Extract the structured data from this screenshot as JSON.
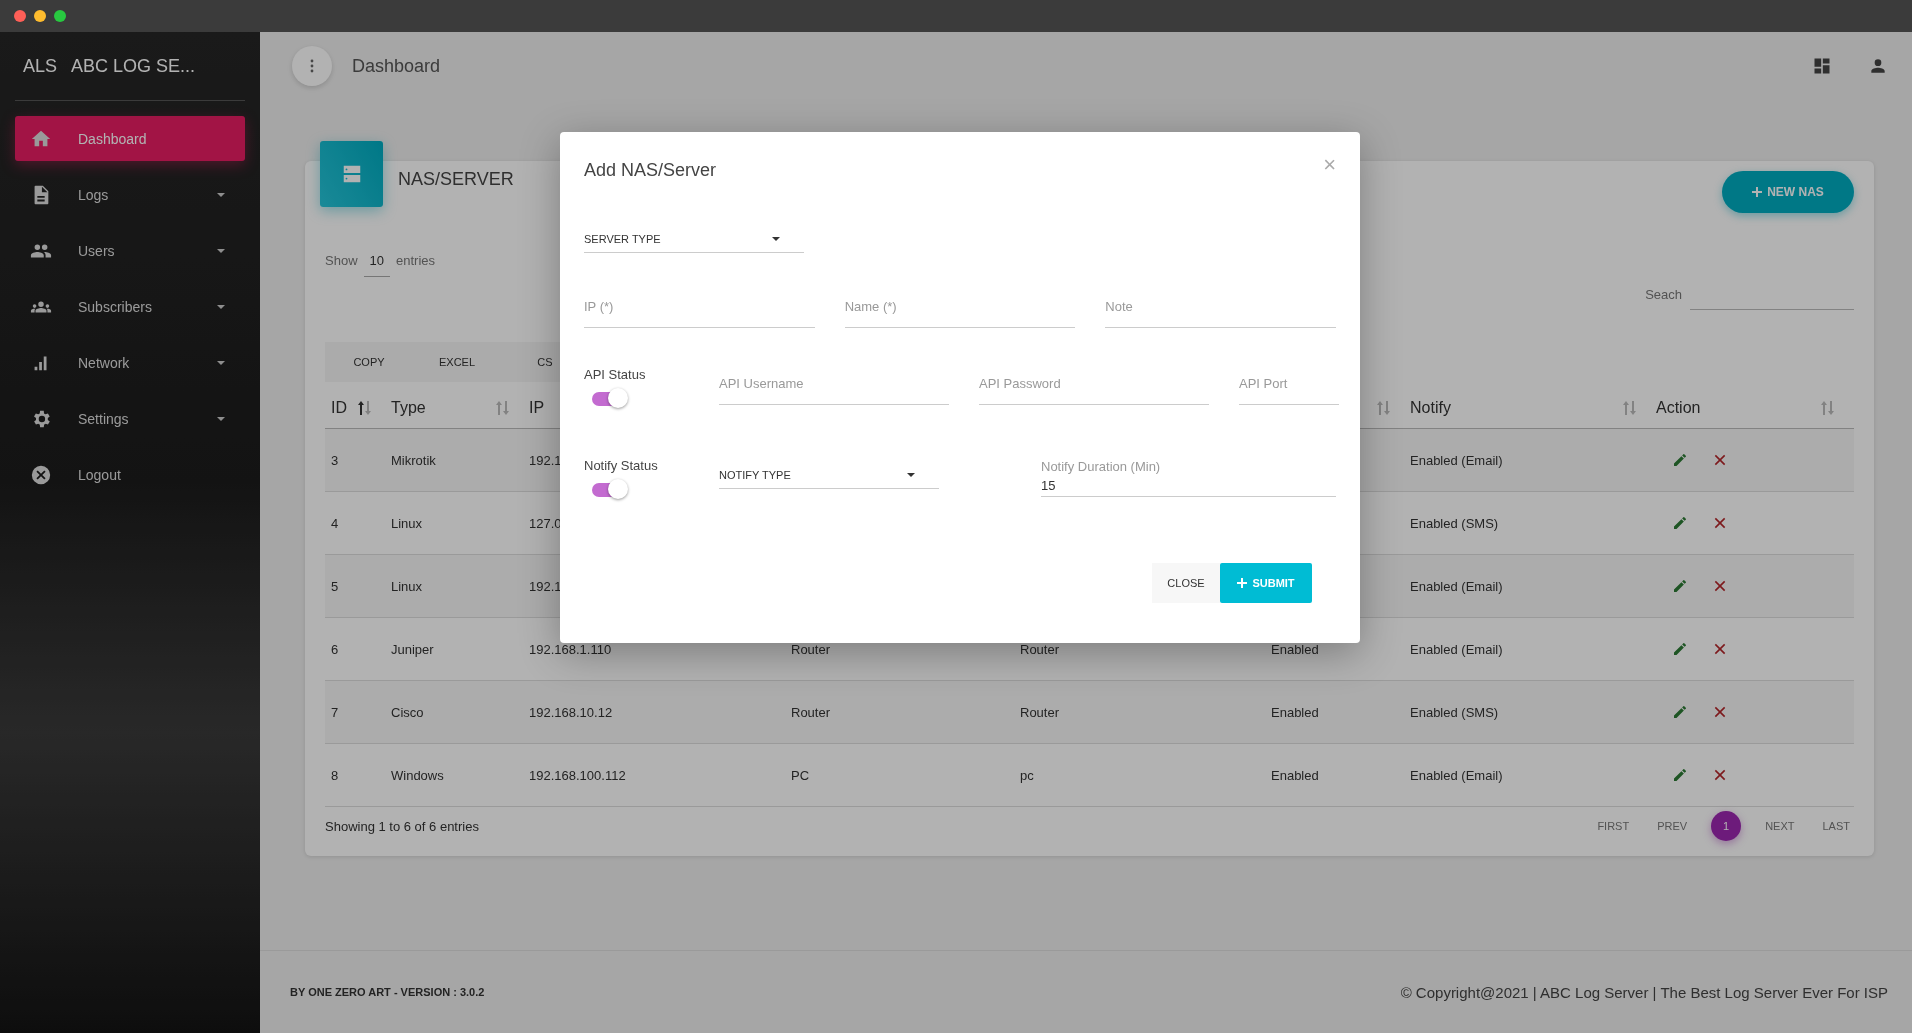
{
  "sidebar": {
    "logo_short": "ALS",
    "logo_text": "ABC LOG SE...",
    "items": [
      {
        "label": "Dashboard",
        "kind": "home",
        "selected": true,
        "submenu": false
      },
      {
        "label": "Logs",
        "kind": "file",
        "selected": false,
        "submenu": true
      },
      {
        "label": "Users",
        "kind": "users",
        "selected": false,
        "submenu": true
      },
      {
        "label": "Subscribers",
        "kind": "group",
        "selected": false,
        "submenu": true
      },
      {
        "label": "Network",
        "kind": "bars",
        "selected": false,
        "submenu": true
      },
      {
        "label": "Settings",
        "kind": "gear",
        "selected": false,
        "submenu": true
      },
      {
        "label": "Logout",
        "kind": "close",
        "selected": false,
        "submenu": false
      }
    ]
  },
  "header": {
    "title": "Dashboard"
  },
  "card": {
    "title": "NAS/SERVER",
    "new_button": "NEW NAS",
    "length": {
      "prefix": "Show",
      "value": "10",
      "suffix": "entries"
    },
    "search_label": "Seach",
    "export_buttons": [
      "COPY",
      "EXCEL",
      "CS"
    ],
    "columns": [
      {
        "label": "ID",
        "sorted": true
      },
      {
        "label": "Type",
        "sorted": false
      },
      {
        "label": "IP"
      },
      {},
      {},
      {
        "sorted": false
      },
      {
        "label": "Notify",
        "sorted": false
      },
      {
        "label": "Action",
        "sorted": false
      }
    ],
    "rows": [
      {
        "id": "3",
        "type": "Mikrotik",
        "ip": "192.1",
        "notify": "Enabled (Email)"
      },
      {
        "id": "4",
        "type": "Linux",
        "ip": "127.0",
        "notify": "Enabled (SMS)"
      },
      {
        "id": "5",
        "type": "Linux",
        "ip": "192.1",
        "notify": "Enabled (Email)"
      },
      {
        "id": "6",
        "type": "Juniper",
        "ip": "192.168.1.110",
        "column_4": "Router",
        "column_5": "Router",
        "column_6": "Enabled",
        "notify": "Enabled (Email)"
      },
      {
        "id": "7",
        "type": "Cisco",
        "ip": "192.168.10.12",
        "column_4": "Router",
        "column_5": "Router",
        "column_6": "Enabled",
        "notify": "Enabled (SMS)"
      },
      {
        "id": "8",
        "type": "Windows",
        "ip": "192.168.100.112",
        "column_4": "PC",
        "column_5": "pc",
        "column_6": "Enabled",
        "notify": "Enabled (Email)"
      }
    ],
    "info": "Showing 1 to 6 of 6 entries",
    "pages": [
      {
        "label": "FIRST",
        "kind": "nav"
      },
      {
        "label": "PREV",
        "kind": "nav"
      },
      {
        "label": "1",
        "kind": "page",
        "selected": true
      },
      {
        "label": "NEXT",
        "kind": "nav"
      },
      {
        "label": "LAST",
        "kind": "nav"
      }
    ]
  },
  "footer": {
    "left": "BY ONE ZERO ART - VERSION : 3.0.2",
    "right": "© Copyright@2021 | ABC Log Server | The Best Log Server Ever For ISP"
  },
  "modal": {
    "title": "Add NAS/Server",
    "close": "×",
    "server_type": "SERVER TYPE",
    "fields_1": [
      {
        "placeholder": "IP (*)"
      },
      {
        "placeholder": "Name (*)"
      },
      {
        "placeholder": "Note"
      }
    ],
    "api_status": {
      "label": "API Status",
      "on": true
    },
    "fields_2": [
      {
        "placeholder": "API Username"
      },
      {
        "placeholder": "API Password"
      },
      {
        "placeholder": "API Port"
      }
    ],
    "notify_status": {
      "label": "Notify Status",
      "on": true
    },
    "notify_type": "NOTIFY TYPE",
    "duration": {
      "label": "Notify Duration (Min)",
      "value": "15"
    },
    "buttons": {
      "close": "CLOSE",
      "submit": "SUBMIT"
    }
  }
}
